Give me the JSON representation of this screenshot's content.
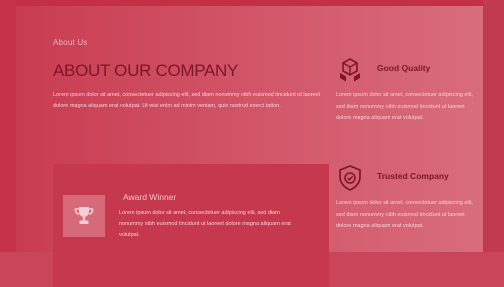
{
  "about": {
    "eyebrow": "About Us",
    "heading": "ABOUT OUR COMPANY",
    "body": "Lorem ipsum dolor sit amet, consectetuer adipiscing elit, sed diam nonummy nibh euismod tincidunt ut laoreet dolore magna aliquam erat volutpat. Ut wisi enim ad minim veniam, quis nostrud exerci tation."
  },
  "award": {
    "title": "Award Winner",
    "icon": "trophy-icon",
    "text": "Lorem ipsum dolor sit amet, consectetuer adipiscing elit, sed diam nonummy nibh euismod tincidunt ut laoreet dolore magna aliquam erat volutpat."
  },
  "features": [
    {
      "title": "Good Quality",
      "icon": "quality-cubes-icon",
      "text": "Lorem ipsum dolor sit amet, consectetuer adipiscing elit, sed diam nonummy nibh euismod tincidunt ut laoreet dolore magna aliquam erat volutpat."
    },
    {
      "title": "Trusted Company",
      "icon": "shield-check-icon",
      "text": "Lorem ipsum dolor sit amet, consectetuer adipiscing elit, sed diam nonummy nibh euismod tincidunt ut laoreet dolore magna aliquam erat volutpat."
    }
  ],
  "colors": {
    "overlay": "#cf4a5e",
    "heading": "#7d1626",
    "card": "#c6384d",
    "text": "#f7d2d8"
  }
}
